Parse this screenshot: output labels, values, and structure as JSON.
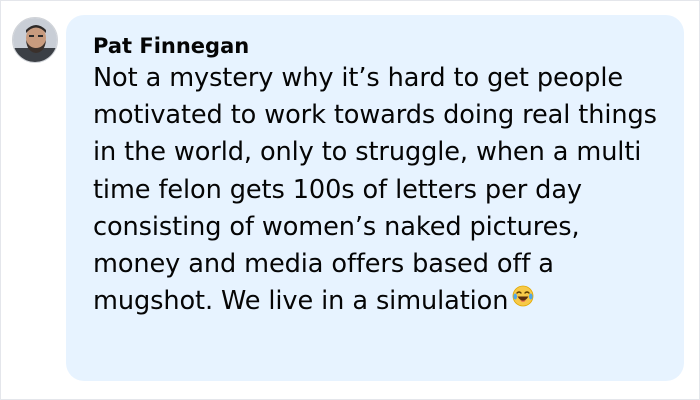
{
  "comment": {
    "author": "Pat Finnegan",
    "text": "Not a mystery why it’s hard to get people motivated to work towards doing real things in the world, only to struggle, when a multi time felon gets 100s of letters per day consisting of women’s naked pictures, money and media offers based off a mugshot. We live in a simulation",
    "emoji": "laughing-with-tears-icon"
  },
  "colors": {
    "bubble_bg": "#e7f3ff",
    "text": "#050505",
    "border": "#e4e6eb"
  }
}
